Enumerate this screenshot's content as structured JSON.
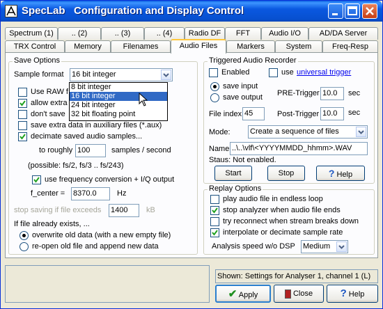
{
  "window": {
    "title": "SpecLab   Configuration and Display Control"
  },
  "tabs_row1": [
    "Spectrum (1)",
    ".. (2)",
    ".. (3)",
    ".. (4)",
    "Radio DF",
    "FFT",
    "Audio I/O",
    "AD/DA Server"
  ],
  "tabs_row2": [
    "TRX Control",
    "Memory",
    "Filenames",
    "Audio Files",
    "Markers",
    "System",
    "Freq-Resp"
  ],
  "save": {
    "group_title": "Save Options",
    "format_label": "Sample format",
    "format_value": "16 bit integer",
    "format_options": [
      "8 bit integer",
      "16 bit integer",
      "24 bit integer",
      "32 bit floating point"
    ],
    "use_raw": "Use RAW f",
    "allow_extra": "allow extra",
    "dont_save": "don't save",
    "save_extra": "save extra data in auxiliary files (*.aux)",
    "decimate": "decimate saved audio samples...",
    "to_roughly": "to roughly",
    "roughly_value": "100",
    "samples_unit": "samples / second",
    "possible": "(possible: fs/2, fs/3 .. fs/243)",
    "use_freq_conv": "use frequency conversion + I/Q output",
    "f_center_label": "f_center =",
    "f_center_value": "8370.0",
    "f_center_unit": "Hz",
    "stop_saving_label": "stop saving if file exceeds",
    "stop_saving_value": "1400",
    "stop_saving_unit": "kB",
    "exists_label": "If file already exists, ...",
    "overwrite": "overwrite old data (with a new empty file)",
    "reopen": "re-open old file and append new data"
  },
  "triggered": {
    "group_title": "Triggered Audio Recorder",
    "enabled": "Enabled",
    "use": "use",
    "universal_trigger": "universal trigger",
    "save_input": "save input",
    "save_output": "save output",
    "pre_trigger_label": "PRE-Trigger",
    "pre_trigger_value": "10.0",
    "post_trigger_label": "Post-Trigger",
    "post_trigger_value": "10.0",
    "sec": "sec",
    "file_index_label": "File index",
    "file_index_value": "45",
    "mode_label": "Mode:",
    "mode_value": "Create a sequence of files",
    "name_label": "Name:",
    "name_value": "..\\..\\vlf\\<YYYYMMDD_hhmm>.WAV",
    "status": "Staus: Not enabled.",
    "start": "Start",
    "stop": "Stop",
    "help": "Help"
  },
  "replay": {
    "group_title": "Replay Options",
    "endless": "play audio file in endless loop",
    "stop_analyzer": "stop analyzer when audio file ends",
    "try_reconnect": "try reconnect when stream breaks down",
    "interpolate": "interpolate or decimate sample rate",
    "speed_label": "Analysis speed w/o DSP",
    "speed_value": "Medium"
  },
  "footer": {
    "shown": "Shown: Settings for Analyser 1, channel 1 (L)",
    "apply": "Apply",
    "close": "Close",
    "help": "Help"
  }
}
